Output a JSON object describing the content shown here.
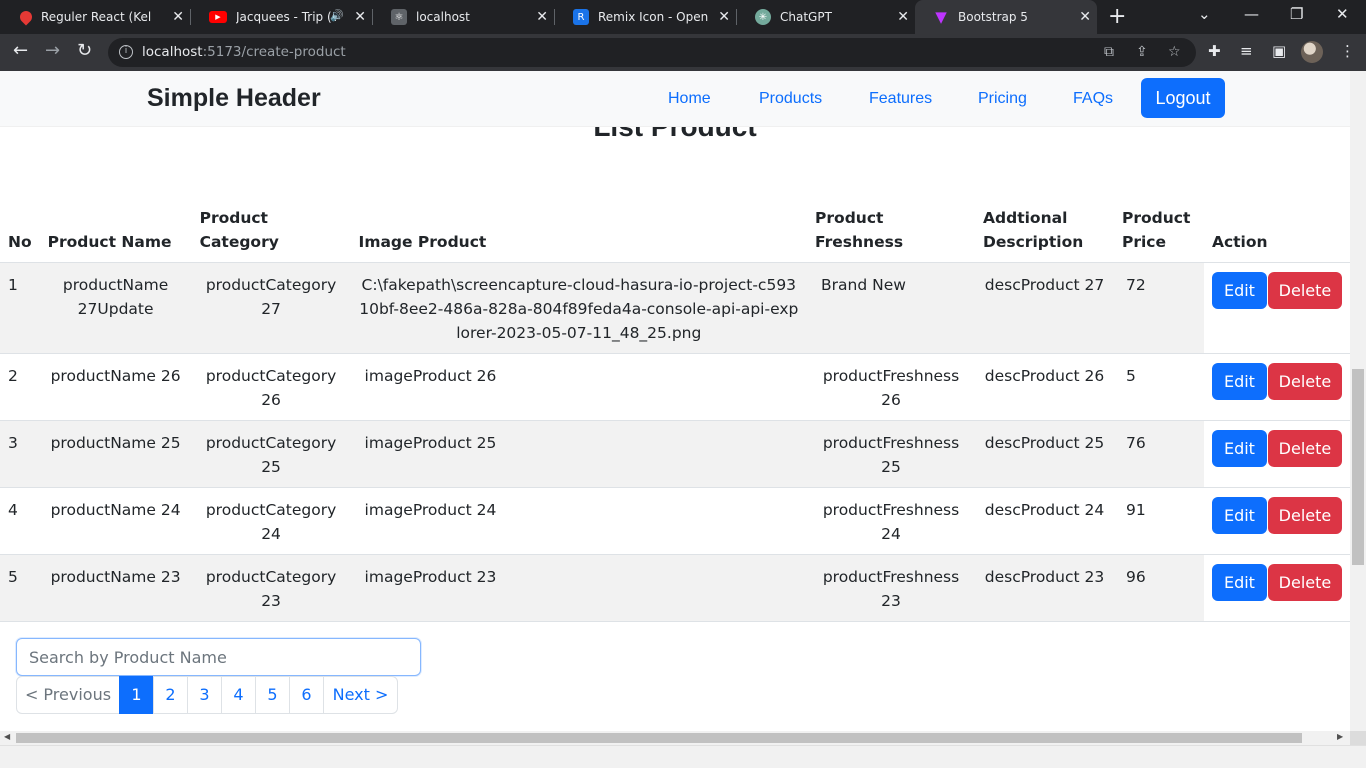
{
  "browser": {
    "tabs": [
      {
        "title": "Reguler React (Kelas A",
        "icon": "drop-icon",
        "color": "#e53935"
      },
      {
        "title": "Jacquees - Trip (of",
        "icon": "youtube-icon",
        "color": "#ff0000"
      },
      {
        "title": "localhost",
        "icon": "react-icon",
        "color": "#5f6368"
      },
      {
        "title": "Remix Icon - Open so",
        "icon": "remix-icon",
        "color": "#1a73e8"
      },
      {
        "title": "ChatGPT",
        "icon": "chatgpt-icon",
        "color": "#74aa9c"
      },
      {
        "title": "Bootstrap 5",
        "icon": "vite-icon",
        "color": "#bd34fe"
      }
    ],
    "url_host": "localhost",
    "url_path": ":5173/create-product"
  },
  "header": {
    "brand": "Simple Header",
    "nav": [
      "Home",
      "Products",
      "Features",
      "Pricing",
      "FAQs"
    ],
    "logout_label": "Logout"
  },
  "main": {
    "title": "List Product",
    "table": {
      "columns": [
        "No",
        "Product Name",
        "Product Category",
        "Image Product",
        "Product Freshness",
        "Addtional Description",
        "Product Price",
        "Action"
      ],
      "rows": [
        {
          "no": "1",
          "name": "productName 27Update",
          "category": "productCategory 27",
          "image": "C:\\fakepath\\screencapture-cloud-hasura-io-project-c59310bf-8ee2-486a-828a-804f89feda4a-console-api-api-explorer-2023-05-07-11_48_25.png",
          "freshness": "Brand New",
          "description": "descProduct 27",
          "price": "72"
        },
        {
          "no": "2",
          "name": "productName 26",
          "category": "productCategory 26",
          "image": "imageProduct 26",
          "freshness": "productFreshness 26",
          "description": "descProduct 26",
          "price": "5"
        },
        {
          "no": "3",
          "name": "productName 25",
          "category": "productCategory 25",
          "image": "imageProduct 25",
          "freshness": "productFreshness 25",
          "description": "descProduct 25",
          "price": "76"
        },
        {
          "no": "4",
          "name": "productName 24",
          "category": "productCategory 24",
          "image": "imageProduct 24",
          "freshness": "productFreshness 24",
          "description": "descProduct 24",
          "price": "91"
        },
        {
          "no": "5",
          "name": "productName 23",
          "category": "productCategory 23",
          "image": "imageProduct 23",
          "freshness": "productFreshness 23",
          "description": "descProduct 23",
          "price": "96"
        }
      ],
      "edit_label": "Edit",
      "delete_label": "Delete"
    },
    "search": {
      "placeholder": "Search by Product Name",
      "value": ""
    },
    "pagination": {
      "previous": "< Previous",
      "pages": [
        "1",
        "2",
        "3",
        "4",
        "5",
        "6"
      ],
      "active_page": "1",
      "next": "Next >"
    }
  },
  "colors": {
    "primary": "#0d6efd",
    "danger": "#dc3545",
    "stripe": "#f2f2f2"
  }
}
